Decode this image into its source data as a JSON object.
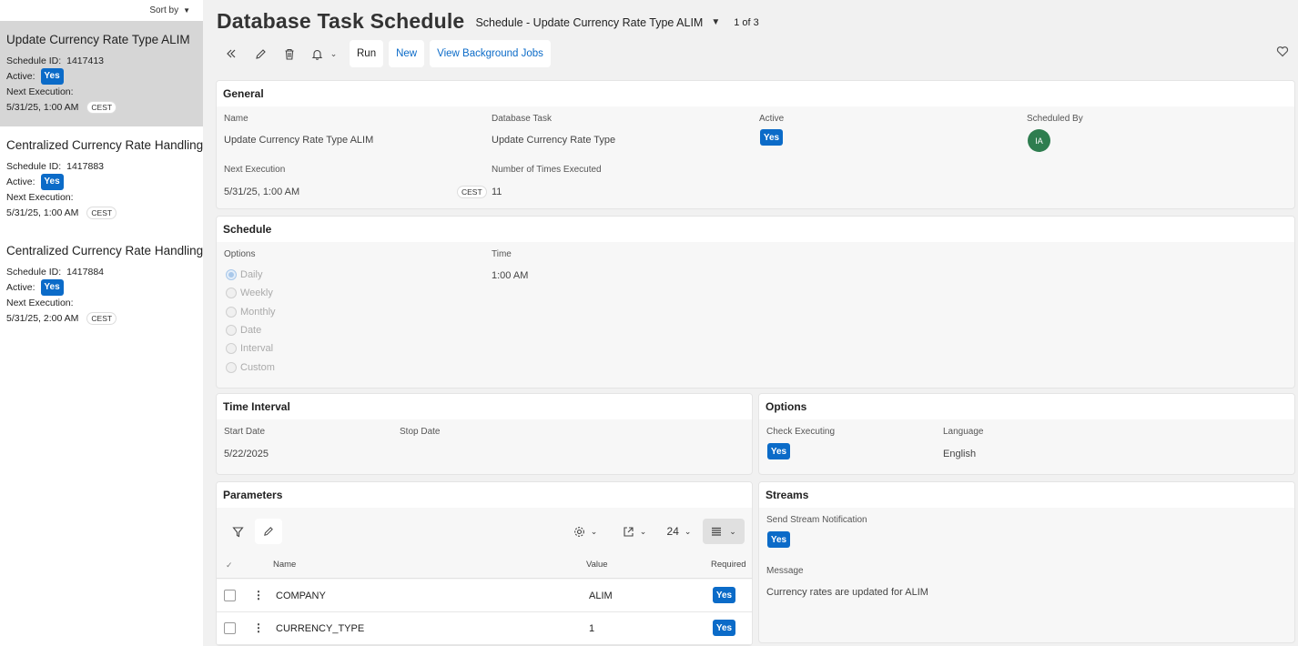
{
  "sidebar": {
    "sort_label": "Sort by",
    "items": [
      {
        "title": "Update Currency Rate Type ALIM",
        "schedule_id_label": "Schedule ID:",
        "schedule_id": "1417413",
        "active_label": "Active:",
        "active": "Yes",
        "next_label": "Next Execution:",
        "next": "5/31/25, 1:00 AM",
        "tz": "CEST"
      },
      {
        "title": "Centralized Currency Rate Handling S",
        "schedule_id_label": "Schedule ID:",
        "schedule_id": "1417883",
        "active_label": "Active:",
        "active": "Yes",
        "next_label": "Next Execution:",
        "next": "5/31/25, 1:00 AM",
        "tz": "CEST"
      },
      {
        "title": "Centralized Currency Rate Handling S",
        "schedule_id_label": "Schedule ID:",
        "schedule_id": "1417884",
        "active_label": "Active:",
        "active": "Yes",
        "next_label": "Next Execution:",
        "next": "5/31/25, 2:00 AM",
        "tz": "CEST"
      }
    ]
  },
  "header": {
    "title": "Database Task Schedule",
    "record": "Schedule - Update Currency Rate Type ALIM",
    "count": "1 of 3"
  },
  "toolbar": {
    "run": "Run",
    "new": "New",
    "background_jobs": "View Background Jobs"
  },
  "general": {
    "title": "General",
    "name_label": "Name",
    "name": "Update Currency Rate Type ALIM",
    "task_label": "Database Task",
    "task": "Update Currency Rate Type",
    "active_label": "Active",
    "active": "Yes",
    "scheduled_by_label": "Scheduled By",
    "scheduled_by_initials": "IA",
    "next_label": "Next Execution",
    "next": "5/31/25, 1:00 AM",
    "next_tz": "CEST",
    "times_label": "Number of Times Executed",
    "times": "11"
  },
  "schedule": {
    "title": "Schedule",
    "options_label": "Options",
    "options": [
      "Daily",
      "Weekly",
      "Monthly",
      "Date",
      "Interval",
      "Custom"
    ],
    "selected": "Daily",
    "time_label": "Time",
    "time": "1:00 AM"
  },
  "interval": {
    "title": "Time Interval",
    "start_label": "Start Date",
    "start": "5/22/2025",
    "stop_label": "Stop Date",
    "stop": ""
  },
  "options_panel": {
    "title": "Options",
    "check_label": "Check Executing",
    "check": "Yes",
    "language_label": "Language",
    "language": "English"
  },
  "parameters": {
    "title": "Parameters",
    "page_size": "24",
    "columns": {
      "name": "Name",
      "value": "Value",
      "required": "Required"
    },
    "rows": [
      {
        "name": "COMPANY",
        "value": "ALIM",
        "required": "Yes"
      },
      {
        "name": "CURRENCY_TYPE",
        "value": "1",
        "required": "Yes"
      }
    ]
  },
  "streams": {
    "title": "Streams",
    "send_label": "Send Stream Notification",
    "send": "Yes",
    "message_label": "Message",
    "message": "Currency rates are updated for ALIM"
  },
  "colors": {
    "accent": "#0b6bc8",
    "avatar": "#2e7d4f",
    "selected_item": "#d6d6d6"
  }
}
